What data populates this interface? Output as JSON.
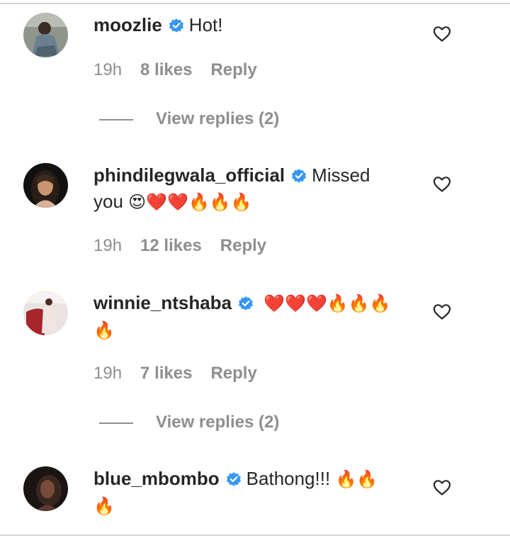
{
  "colors": {
    "verified": "#3897f0",
    "text": "#262626",
    "secondary": "#8e8e8e",
    "heart": "#ed2e3a",
    "fire": "#f58220"
  },
  "comments": [
    {
      "username": "moozlie",
      "text": "Hot!",
      "emoji": "",
      "emoji_line2": "",
      "time": "19h",
      "likes": "8 likes",
      "reply": "Reply",
      "view_replies": "View replies (2)"
    },
    {
      "username": "phindilegwala_official",
      "text": "Missed",
      "text_line2": "you",
      "emoji": "😍❤️❤️🔥🔥🔥",
      "time": "19h",
      "likes": "12 likes",
      "reply": "Reply"
    },
    {
      "username": "winnie_ntshaba",
      "text": "",
      "emoji": "❤️❤️❤️🔥🔥🔥",
      "emoji_line2": "🔥",
      "time": "19h",
      "likes": "7 likes",
      "reply": "Reply",
      "view_replies": "View replies (2)"
    },
    {
      "username": "blue_mbombo",
      "text": "Bathong!!!",
      "emoji": "🔥🔥",
      "emoji_line2": "🔥"
    }
  ],
  "icons": {
    "verified": "verified-badge-icon",
    "like": "heart-outline-icon",
    "avatar": "profile-picture"
  }
}
